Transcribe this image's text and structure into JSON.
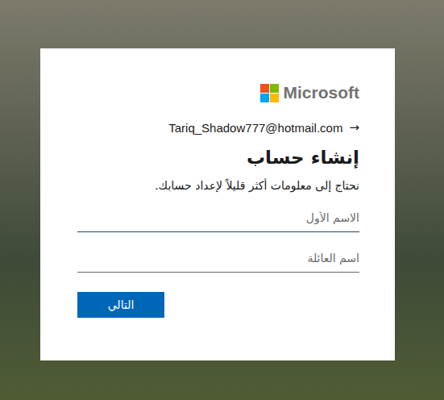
{
  "logo": {
    "text": "Microsoft"
  },
  "account": {
    "back_icon": "→",
    "email": "Tariq_Shadow777@hotmail.com"
  },
  "title": "إنشاء حساب",
  "subtitle": "نحتاج إلى معلومات أكثر قليلاً لإعداد حسابك.",
  "fields": [
    {
      "name": "first-name",
      "placeholder": "الاسم الأول",
      "focused": true
    },
    {
      "name": "last-name",
      "placeholder": "اسم العائلة",
      "focused": false
    }
  ],
  "buttons": [
    {
      "label": "التالي"
    }
  ]
}
